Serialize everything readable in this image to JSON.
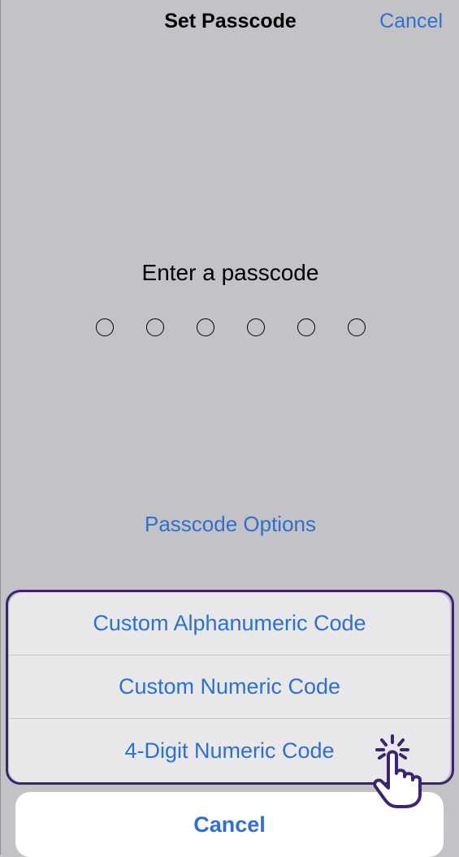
{
  "nav": {
    "title": "Set Passcode",
    "cancel_label": "Cancel"
  },
  "prompt": {
    "text": "Enter a passcode"
  },
  "passcode": {
    "length": 6,
    "filled": 0
  },
  "options_link": {
    "label": "Passcode Options"
  },
  "action_sheet": {
    "options": [
      {
        "label": "Custom Alphanumeric Code"
      },
      {
        "label": "Custom Numeric Code"
      },
      {
        "label": "4-Digit Numeric Code"
      }
    ],
    "cancel_label": "Cancel"
  },
  "colors": {
    "accent": "#2e6fd0",
    "background": "#c3c2c7",
    "highlight": "#3d2470"
  },
  "icons": {
    "cursor": "hand-pointer-tap-icon"
  }
}
